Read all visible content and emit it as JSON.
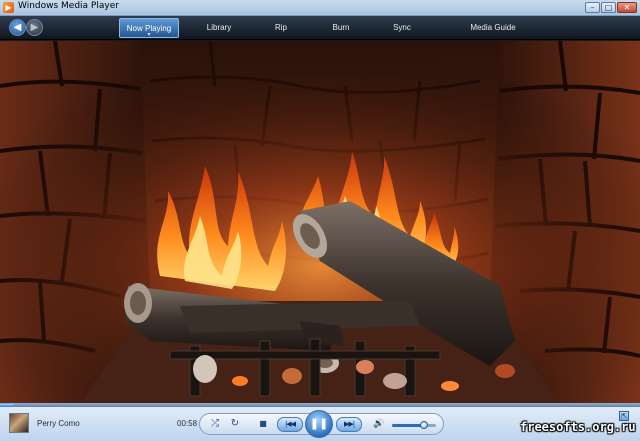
{
  "window": {
    "title": "Windows Media Player",
    "app_icon": "media-player-icon",
    "minimize_glyph": "–",
    "maximize_glyph": "□",
    "close_glyph": "✕"
  },
  "nav": {
    "back_glyph": "◀",
    "forward_glyph": "▶",
    "active_tab_glyph": "▾",
    "tabs": [
      {
        "label": "Now Playing",
        "active": true
      },
      {
        "label": "Library",
        "active": false
      },
      {
        "label": "Rip",
        "active": false
      },
      {
        "label": "Burn",
        "active": false
      },
      {
        "label": "Sync",
        "active": false
      },
      {
        "label": "Media Guide",
        "active": false
      }
    ]
  },
  "video": {
    "scene": "fireplace-visualization"
  },
  "player": {
    "artist": "Perry Como",
    "elapsed": "00:58",
    "seek_progress": 0.02,
    "volume_level": 0.72,
    "shuffle_glyph": "⤮",
    "repeat_glyph": "↻",
    "stop_glyph": "■",
    "previous_glyph": "|◀◀",
    "play_pause_glyph": "❚❚",
    "next_glyph": "▶▶|",
    "volume_glyph": "🔊",
    "switch_to_skin_glyph": "⇱"
  },
  "watermark": "freesofts.org.ru",
  "colors": {
    "accent": "#2f6fc0",
    "titlebar": "#b9cfe6",
    "navbar": "#1a2330",
    "controls": "#d2e2f4"
  }
}
